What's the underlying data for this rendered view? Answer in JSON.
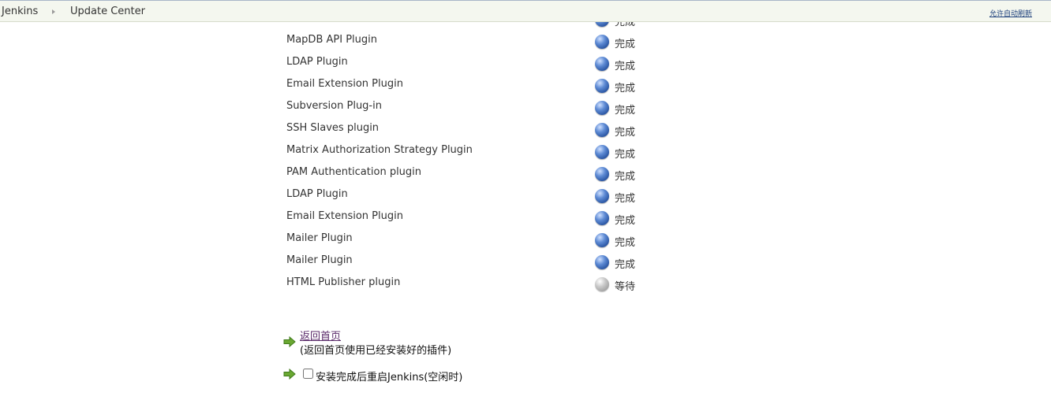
{
  "breadcrumb": {
    "home": "Jenkins",
    "current": "Update Center"
  },
  "header": {
    "auto_refresh": "允许自动刷新"
  },
  "plugins": [
    {
      "name": "",
      "status": "完成",
      "state": "done"
    },
    {
      "name": "MapDB API Plugin",
      "status": "完成",
      "state": "done"
    },
    {
      "name": "LDAP Plugin",
      "status": "完成",
      "state": "done"
    },
    {
      "name": "Email Extension Plugin",
      "status": "完成",
      "state": "done"
    },
    {
      "name": "Subversion Plug-in",
      "status": "完成",
      "state": "done"
    },
    {
      "name": "SSH Slaves plugin",
      "status": "完成",
      "state": "done"
    },
    {
      "name": "Matrix Authorization Strategy Plugin",
      "status": "完成",
      "state": "done"
    },
    {
      "name": "PAM Authentication plugin",
      "status": "完成",
      "state": "done"
    },
    {
      "name": "LDAP Plugin",
      "status": "完成",
      "state": "done"
    },
    {
      "name": "Email Extension Plugin",
      "status": "完成",
      "state": "done"
    },
    {
      "name": "Mailer Plugin",
      "status": "完成",
      "state": "done"
    },
    {
      "name": "Mailer Plugin",
      "status": "完成",
      "state": "done"
    },
    {
      "name": "HTML Publisher plugin",
      "status": "等待",
      "state": "pending"
    }
  ],
  "actions": {
    "back_link": "返回首页",
    "back_desc": "(返回首页使用已经安装好的插件)",
    "restart_label": "安装完成后重启Jenkins(空闲时)",
    "restart_checked": false
  },
  "icons": {
    "done": "blue-ball-icon",
    "pending": "grey-ball-icon",
    "arrow": "green-arrow-icon"
  },
  "colors": {
    "done_ball": "#3b6bb8",
    "pending_ball": "#b0b0b0",
    "arrow": "#6aa832"
  }
}
